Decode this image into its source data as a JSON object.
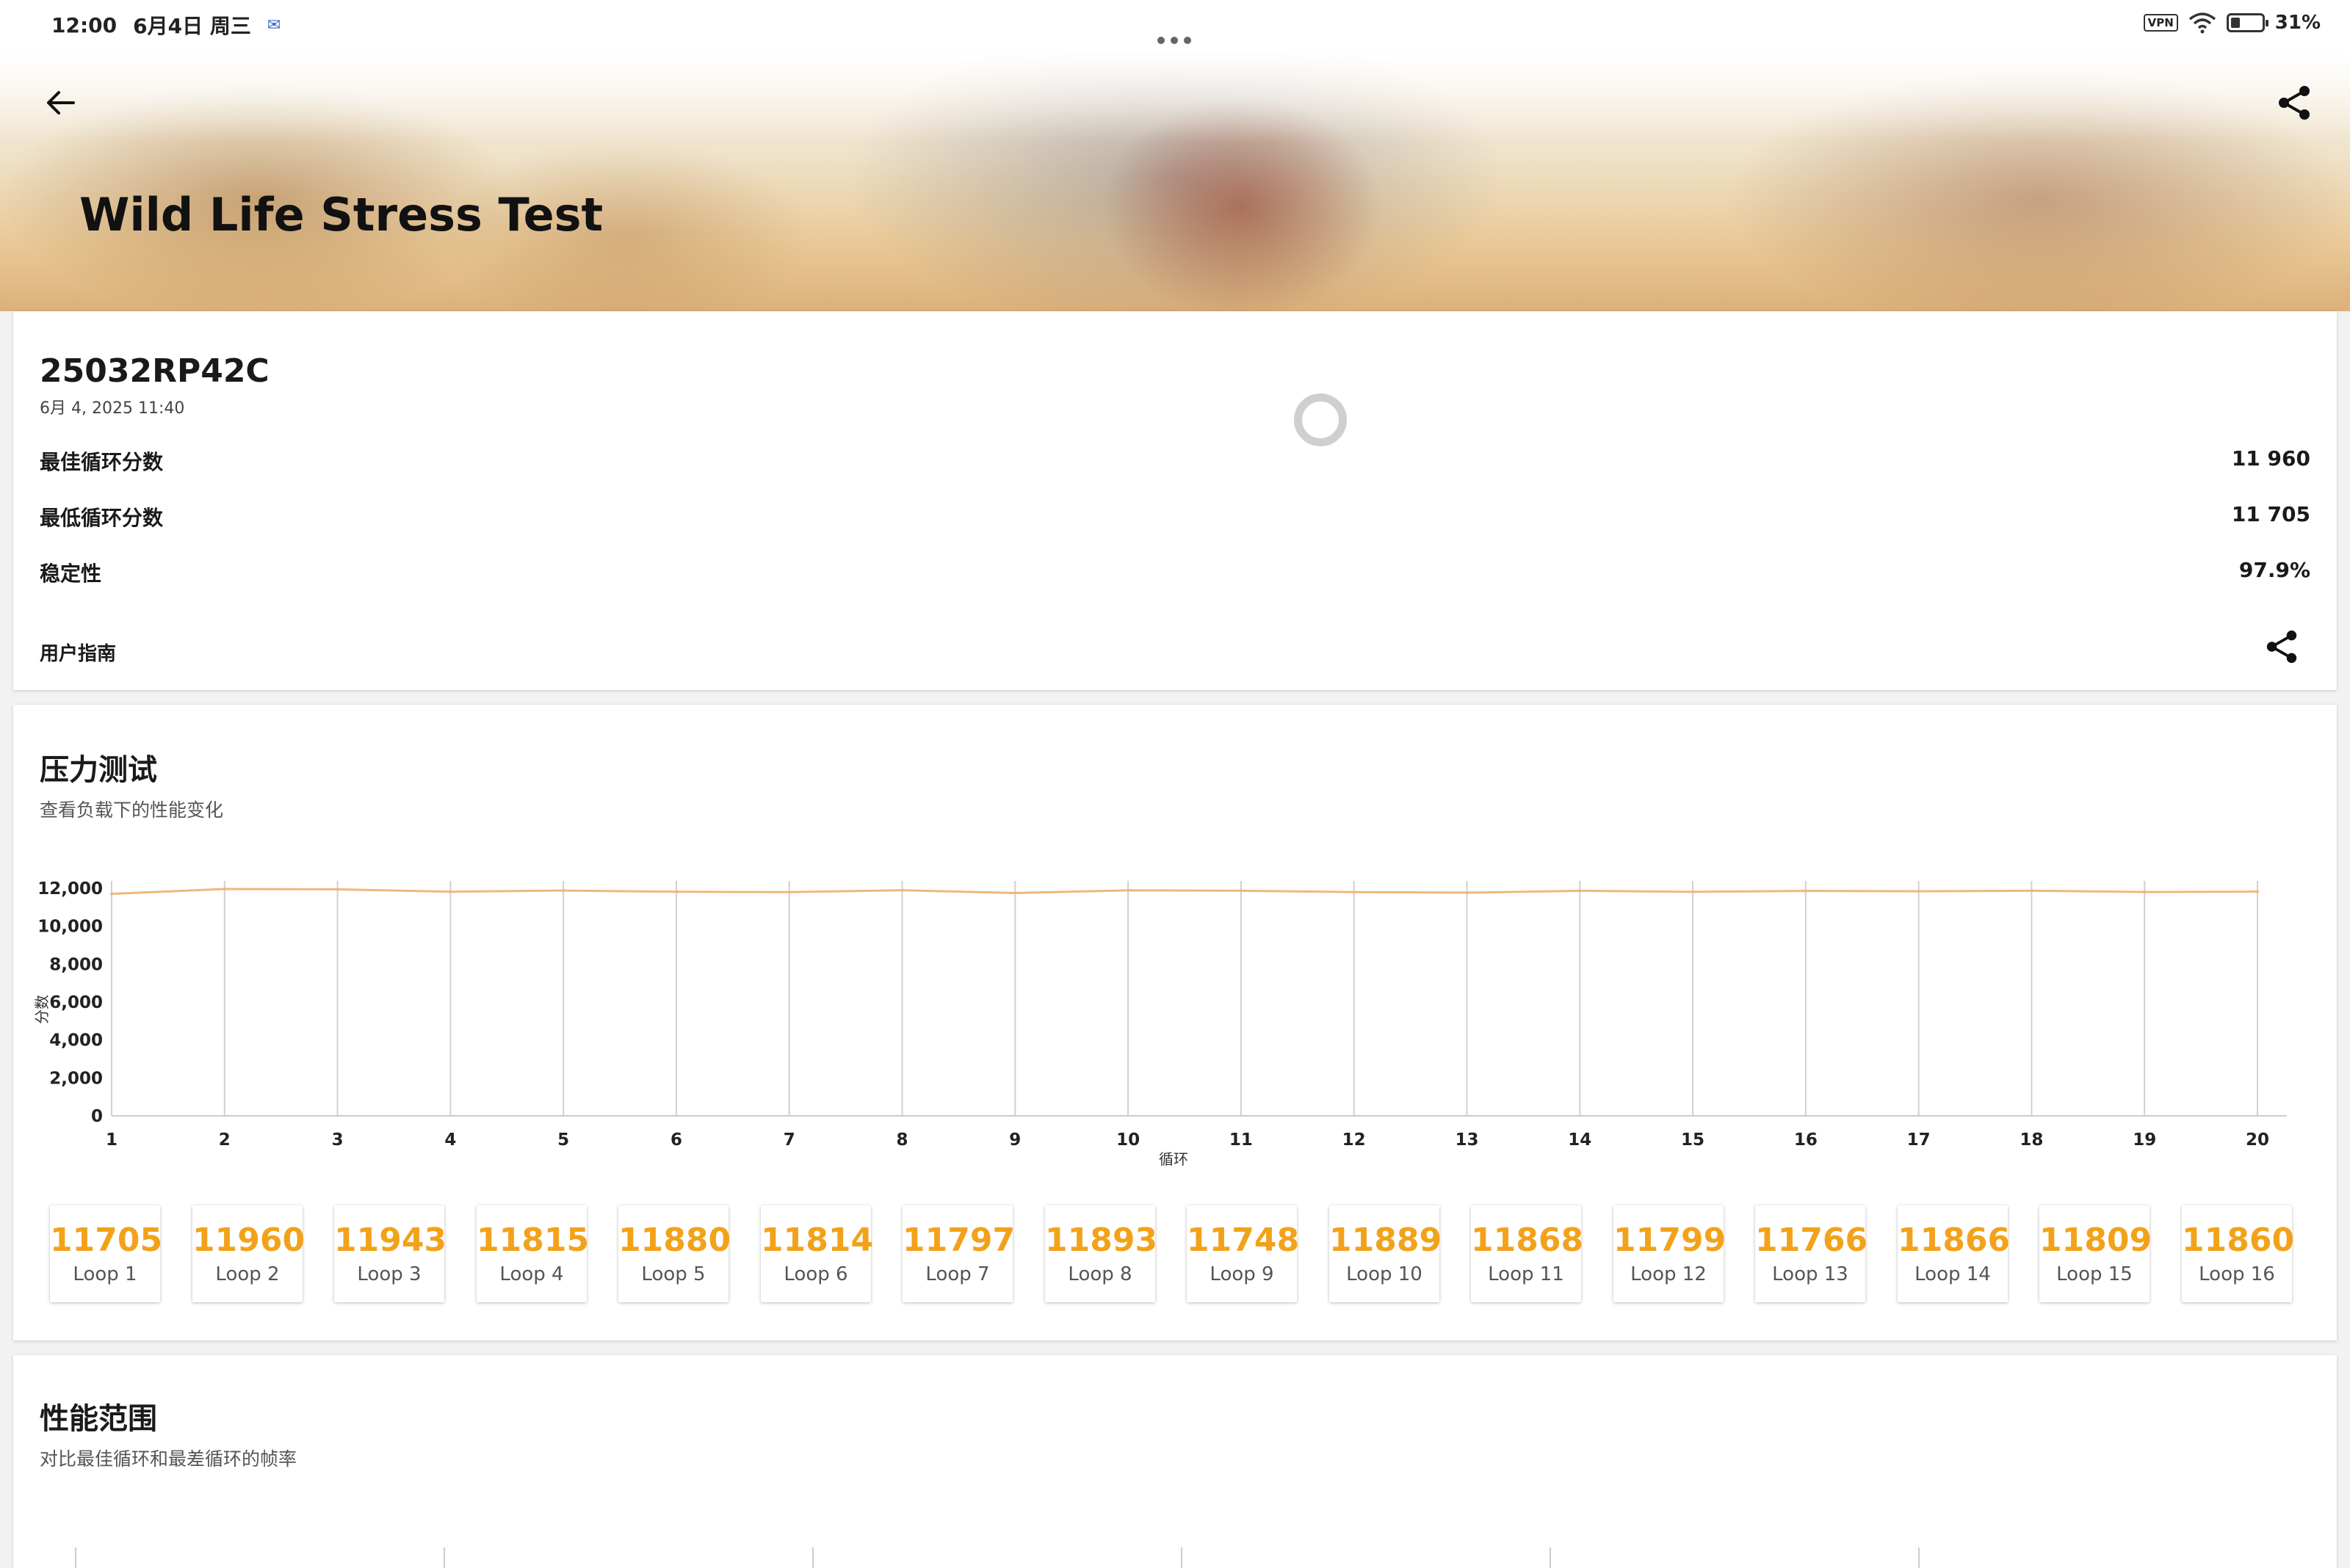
{
  "status_bar": {
    "time": "12:00",
    "date": "6月4日 周三",
    "vpn": "VPN",
    "battery": "31%",
    "battery_level": 0.31
  },
  "header": {
    "title": "Wild Life Stress Test",
    "back_icon": "arrow-left-icon",
    "share_icon": "share-icon"
  },
  "info": {
    "device": "25032RP42C",
    "date": "6月 4, 2025 11:40",
    "rows": [
      {
        "label": "最佳循环分数",
        "value": "11 960"
      },
      {
        "label": "最低循环分数",
        "value": "11 705"
      },
      {
        "label": "稳定性",
        "value": "97.9%"
      }
    ],
    "guide_label": "用户指南"
  },
  "stress": {
    "title": "压力测试",
    "subtitle": "查看负载下的性能变化"
  },
  "chart_data": {
    "type": "line",
    "xlabel": "循环",
    "ylabel": "分数",
    "x": [
      1,
      2,
      3,
      4,
      5,
      6,
      7,
      8,
      9,
      10,
      11,
      12,
      13,
      14,
      15,
      16,
      17,
      18,
      19,
      20
    ],
    "x_ticks": [
      "1",
      "2",
      "3",
      "4",
      "5",
      "6",
      "7",
      "8",
      "9",
      "10",
      "11",
      "12",
      "13",
      "14",
      "15",
      "16",
      "17",
      "18",
      "19",
      "20"
    ],
    "y_ticks": [
      "0",
      "2,000",
      "4,000",
      "6,000",
      "8,000",
      "10,000",
      "12,000"
    ],
    "ylim": [
      0,
      12000
    ],
    "series": [
      {
        "values": [
          11705,
          11960,
          11943,
          11815,
          11880,
          11814,
          11797,
          11893,
          11748,
          11889,
          11868,
          11799,
          11766,
          11866,
          11809,
          11860,
          11840,
          11870,
          11800,
          11820
        ],
        "color": "#f0b77a"
      }
    ],
    "grid": "vertical"
  },
  "loops": [
    {
      "score": "11705",
      "label": "Loop 1"
    },
    {
      "score": "11960",
      "label": "Loop 2"
    },
    {
      "score": "11943",
      "label": "Loop 3"
    },
    {
      "score": "11815",
      "label": "Loop 4"
    },
    {
      "score": "11880",
      "label": "Loop 5"
    },
    {
      "score": "11814",
      "label": "Loop 6"
    },
    {
      "score": "11797",
      "label": "Loop 7"
    },
    {
      "score": "11893",
      "label": "Loop 8"
    },
    {
      "score": "11748",
      "label": "Loop 9"
    },
    {
      "score": "11889",
      "label": "Loop 10"
    },
    {
      "score": "11868",
      "label": "Loop 11"
    },
    {
      "score": "11799",
      "label": "Loop 12"
    },
    {
      "score": "11766",
      "label": "Loop 13"
    },
    {
      "score": "11866",
      "label": "Loop 14"
    },
    {
      "score": "11809",
      "label": "Loop 15"
    },
    {
      "score": "11860",
      "label": "Loop 16"
    }
  ],
  "range": {
    "title": "性能范围",
    "subtitle": "对比最佳循环和最差循环的帧率"
  },
  "colors": {
    "accent": "#f2a21a",
    "line": "#f0b77a"
  }
}
